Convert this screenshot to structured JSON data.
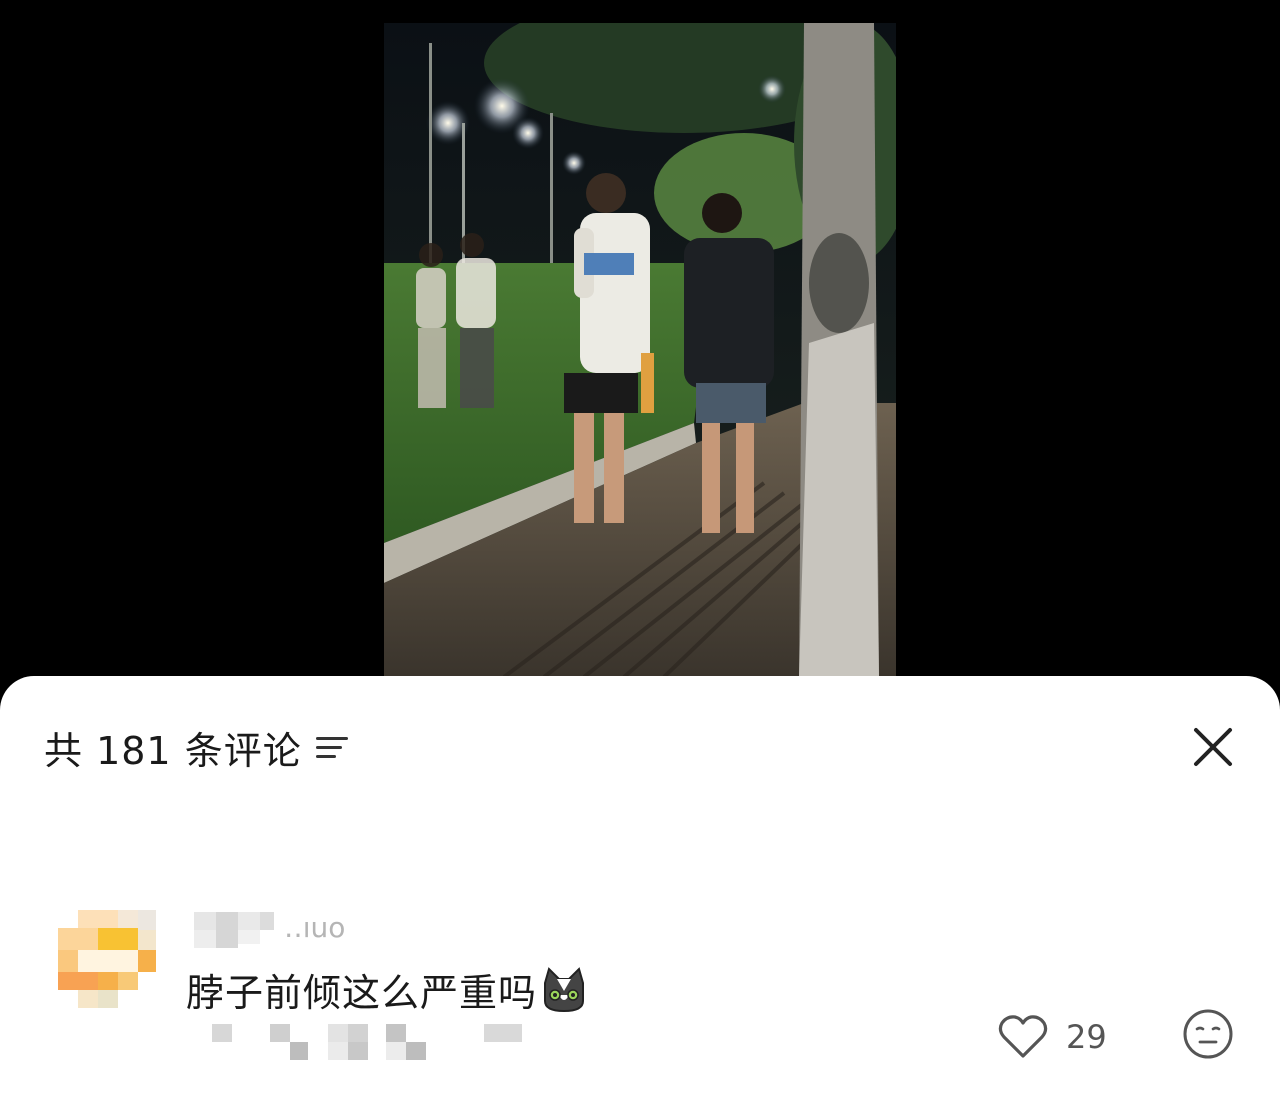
{
  "sheet": {
    "comment_count_label": "共 181 条评论",
    "sort_icon": "sort-lines-icon",
    "close_icon": "close-x-icon"
  },
  "comment": {
    "username_visible_fragment": "‥ıuo",
    "text": "脖子前倾这么严重吗",
    "emoji": "cat-face-emoji",
    "likes": "29",
    "like_icon": "heart-outline-icon",
    "reaction_icon": "face-expression-icon"
  },
  "colors": {
    "sheet_background": "#ffffff",
    "text_primary": "#1a1a1a",
    "icon_gray": "#555555"
  }
}
